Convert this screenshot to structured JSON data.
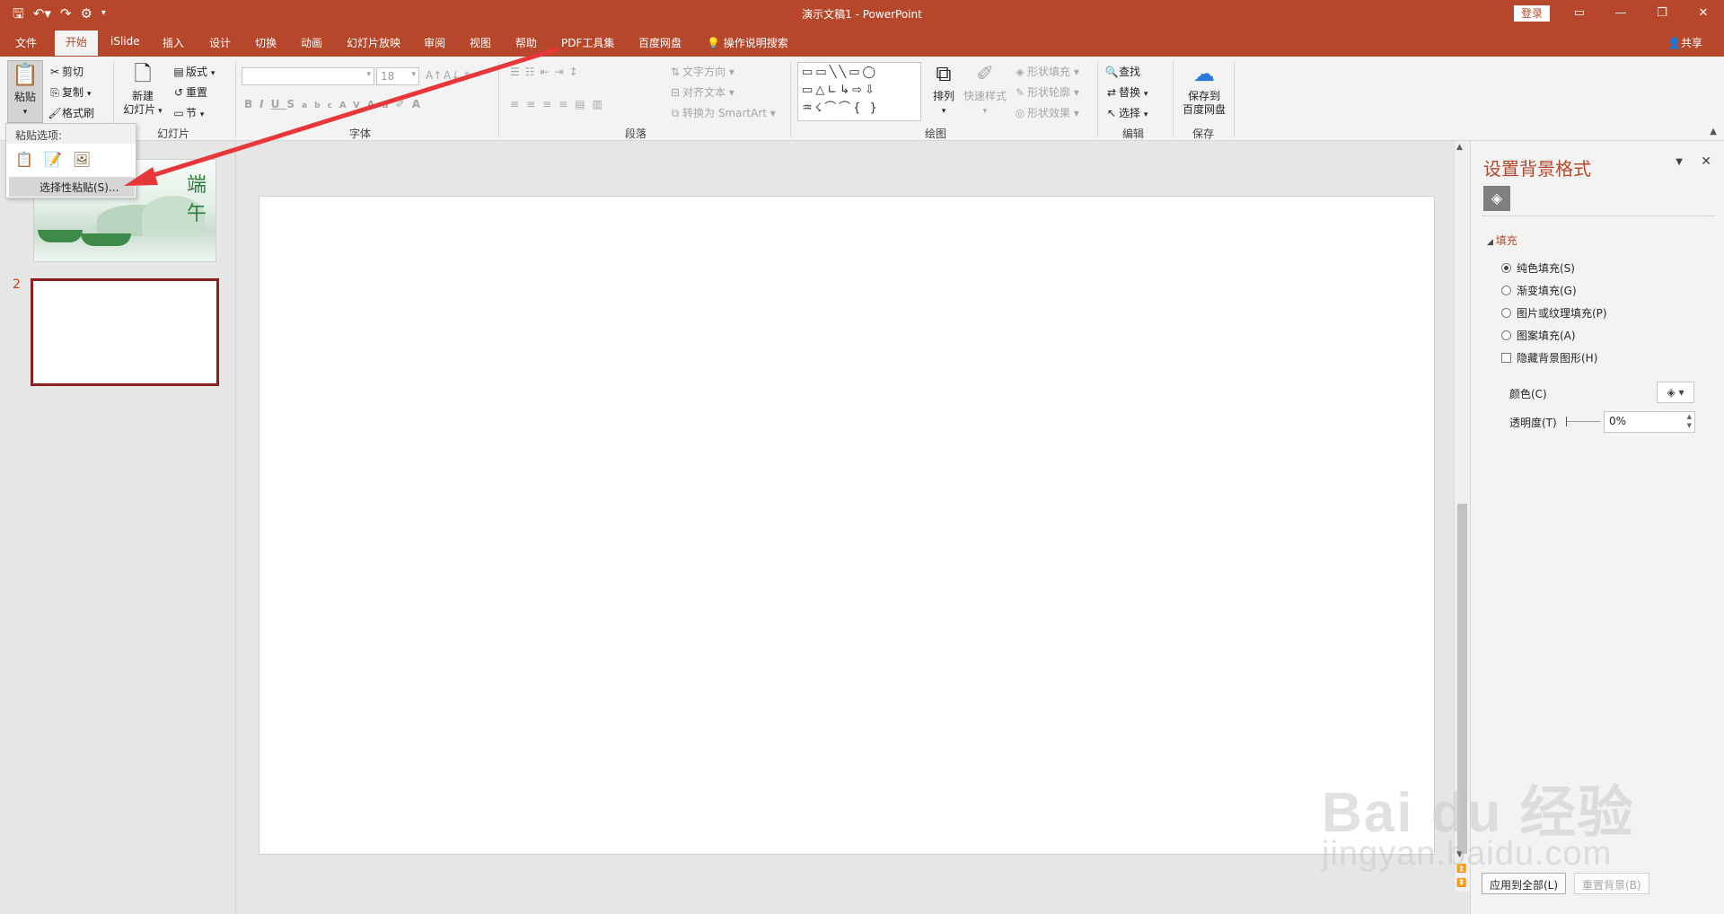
{
  "titlebar": {
    "document_title": "演示文稿1  -  PowerPoint",
    "login_label": "登录",
    "qat_icons": [
      "save-icon",
      "undo-icon",
      "redo-icon",
      "customize-icon"
    ]
  },
  "tabs": {
    "items": [
      "文件",
      "开始",
      "iSlide",
      "插入",
      "设计",
      "切换",
      "动画",
      "幻灯片放映",
      "审阅",
      "视图",
      "帮助",
      "PDF工具集",
      "百度网盘",
      "操作说明搜索"
    ],
    "active": "开始",
    "share_label": "共享"
  },
  "ribbon": {
    "clipboard": {
      "paste": "粘贴",
      "cut": "剪切",
      "copy": "复制",
      "format_painter": "格式刷"
    },
    "slides": {
      "new_slide_line1": "新建",
      "new_slide_line2": "幻灯片",
      "layout": "版式",
      "reset": "重置",
      "section": "节",
      "group_label": "幻灯片"
    },
    "font": {
      "font_size": "18",
      "group_label": "字体"
    },
    "paragraph": {
      "text_direction": "文字方向",
      "align_text": "对齐文本",
      "convert_smartart": "转换为 SmartArt",
      "group_label": "段落"
    },
    "drawing": {
      "arrange": "排列",
      "quick_styles": "快速样式",
      "shape_fill": "形状填充",
      "shape_outline": "形状轮廓",
      "shape_effects": "形状效果",
      "group_label": "绘图"
    },
    "editing": {
      "find": "查找",
      "replace": "替换",
      "select": "选择",
      "group_label": "编辑"
    },
    "save": {
      "save_line1": "保存到",
      "save_line2": "百度网盘",
      "group_label": "保存"
    }
  },
  "paste_menu": {
    "header": "粘贴选项:",
    "item": "选择性粘贴(S)..."
  },
  "thumbnails": {
    "slide2_number": "2"
  },
  "format_pane": {
    "title": "设置背景格式",
    "section": "填充",
    "options": [
      "纯色填充(S)",
      "渐变填充(G)",
      "图片或纹理填充(P)",
      "图案填充(A)"
    ],
    "selected_option": "纯色填充(S)",
    "hide_graphics": "隐藏背景图形(H)",
    "color_label": "颜色(C)",
    "transparency_label": "透明度(T)",
    "transparency_value": "0%",
    "apply_all": "应用到全部(L)",
    "reset_background": "重置背景(B)"
  },
  "watermark": {
    "brand": "Bai du 经验",
    "url": "jingyan.baidu.com"
  },
  "colors": {
    "accent": "#b7472a",
    "annotation_arrow": "#e8373a"
  }
}
